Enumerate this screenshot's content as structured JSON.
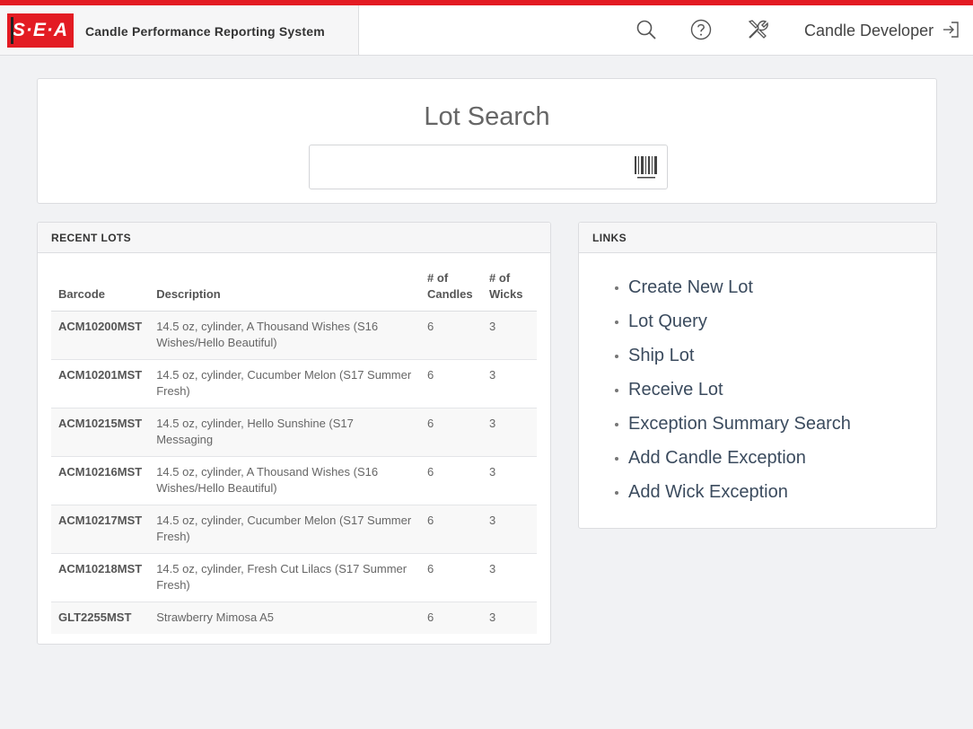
{
  "brand": {
    "logo_text": "S·E·A",
    "app_title": "Candle Performance Reporting System",
    "accent_color": "#e31b23"
  },
  "header": {
    "icons": [
      "search-icon",
      "help-icon",
      "tools-icon"
    ],
    "user_name": "Candle Developer",
    "logout_icon": "sign-out-icon"
  },
  "search": {
    "title": "Lot Search",
    "value": "",
    "placeholder": "",
    "icon": "barcode-icon"
  },
  "recent_lots": {
    "title": "RECENT LOTS",
    "columns": [
      "Barcode",
      "Description",
      "# of Candles",
      "# of Wicks"
    ],
    "rows": [
      {
        "barcode": "ACM10200MST",
        "description": "14.5 oz, cylinder, A Thousand Wishes (S16 Wishes/Hello Beautiful)",
        "candles": "6",
        "wicks": "3"
      },
      {
        "barcode": "ACM10201MST",
        "description": "14.5 oz, cylinder, Cucumber Melon (S17 Summer Fresh)",
        "candles": "6",
        "wicks": "3"
      },
      {
        "barcode": "ACM10215MST",
        "description": "14.5 oz, cylinder, Hello Sunshine (S17 Messaging",
        "candles": "6",
        "wicks": "3"
      },
      {
        "barcode": "ACM10216MST",
        "description": "14.5 oz, cylinder, A Thousand Wishes (S16 Wishes/Hello Beautiful)",
        "candles": "6",
        "wicks": "3"
      },
      {
        "barcode": "ACM10217MST",
        "description": "14.5 oz, cylinder, Cucumber Melon (S17 Summer Fresh)",
        "candles": "6",
        "wicks": "3"
      },
      {
        "barcode": "ACM10218MST",
        "description": "14.5 oz, cylinder, Fresh Cut Lilacs (S17 Summer Fresh)",
        "candles": "6",
        "wicks": "3"
      },
      {
        "barcode": "GLT2255MST",
        "description": "Strawberry Mimosa A5",
        "candles": "6",
        "wicks": "3"
      }
    ]
  },
  "links": {
    "title": "LINKS",
    "items": [
      "Create New Lot",
      "Lot Query",
      "Ship Lot",
      "Receive Lot",
      "Exception Summary Search",
      "Add Candle Exception",
      "Add Wick Exception"
    ]
  }
}
